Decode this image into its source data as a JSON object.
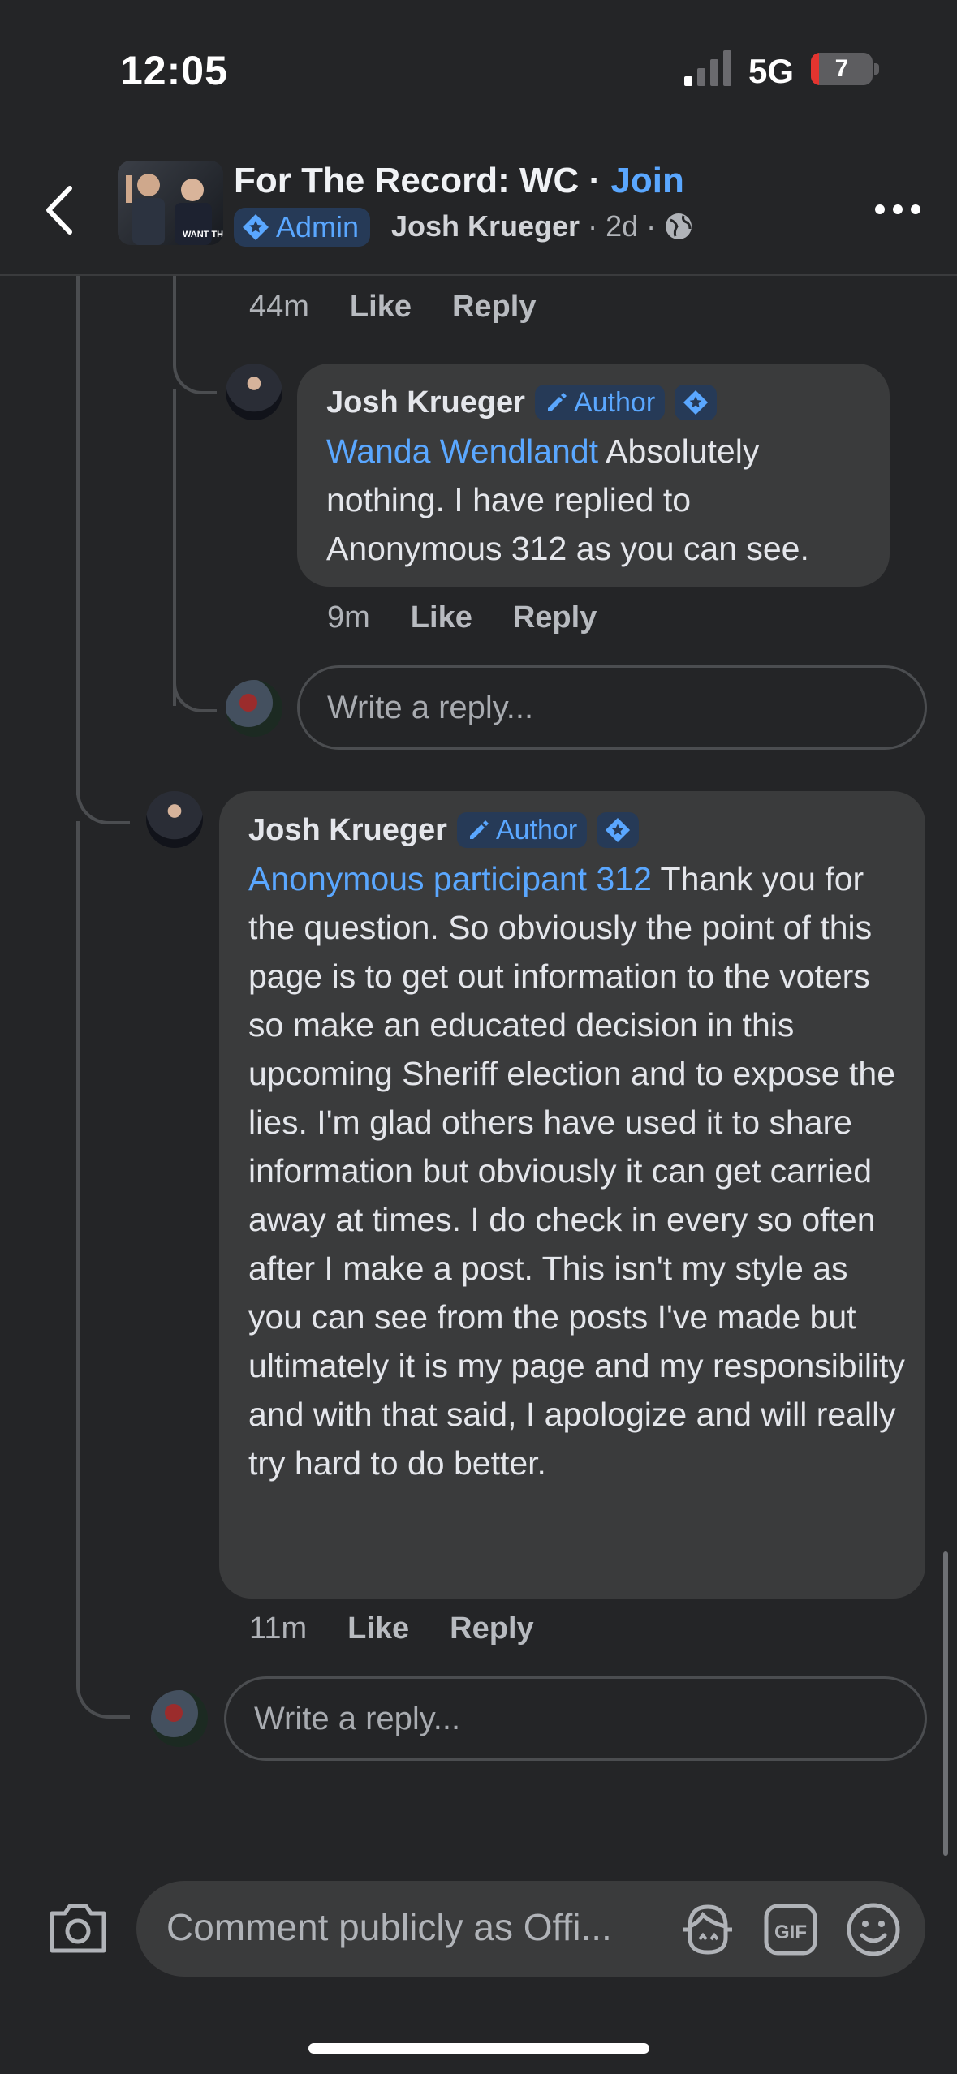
{
  "status_bar": {
    "time": "12:05",
    "network": "5G",
    "battery": "7"
  },
  "header": {
    "group_title": "For The Record: WC",
    "separator": " · ",
    "join_label": "Join",
    "admin_badge": "Admin",
    "author": "Josh Krueger",
    "time": "2d",
    "dot": "·"
  },
  "top_actions": {
    "time": "44m",
    "like": "Like",
    "reply": "Reply"
  },
  "comment_1": {
    "author": "Josh Krueger",
    "author_tag": "Author",
    "mention": "Wanda Wendlandt",
    "text": " Absolutely nothing. I have replied to Anonymous 312 as you can see.",
    "time": "9m",
    "like": "Like",
    "reply": "Reply"
  },
  "reply_field_1": {
    "placeholder": "Write a reply..."
  },
  "comment_2": {
    "author": "Josh Krueger",
    "author_tag": "Author",
    "mention": "Anonymous participant 312",
    "text": " Thank you for the question. So obviously the point of this page is to get out information to the voters so make an educated decision in this upcoming Sheriff election and to expose the lies. I'm glad others have used it to share information but obviously it can get carried away at times. I do check in every so often after I make a post. This isn't my style as you can see from the posts I've made but ultimately it is my page and my responsibility and with that said, I apologize and will really try hard to do better.",
    "time": "11m",
    "like": "Like",
    "reply": "Reply"
  },
  "reply_field_2": {
    "placeholder": "Write a reply..."
  },
  "composer": {
    "placeholder": "Comment publicly as Offi..."
  },
  "icons": {
    "back": "chevron-left-icon",
    "more": "more-dots-icon",
    "camera": "camera-icon",
    "avatar_sticker": "avatar-sticker-icon",
    "gif": "gif-icon",
    "emoji": "emoji-icon",
    "globe": "globe-icon",
    "pencil": "pencil-icon",
    "admin_star": "admin-star-icon"
  },
  "colors": {
    "background": "#242527",
    "bubble": "#3a3b3c",
    "accent": "#5aa7ff",
    "badge_bg": "#263a57"
  }
}
